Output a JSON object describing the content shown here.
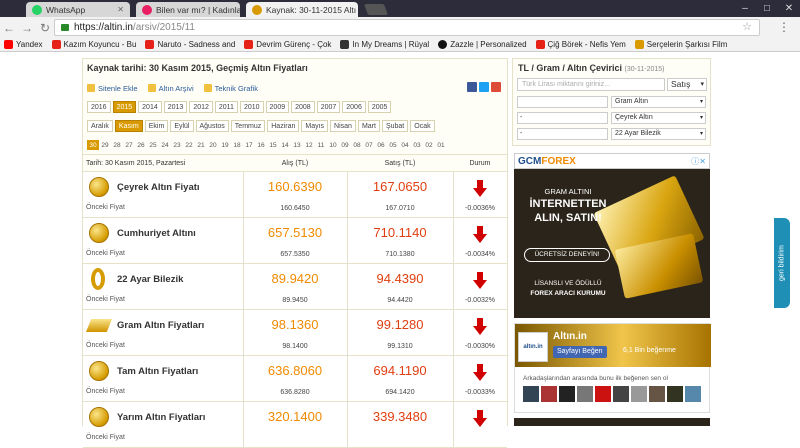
{
  "browser": {
    "tabs": [
      {
        "title": "WhatsApp",
        "color": "#25d366"
      },
      {
        "title": "Bilen var mı? | Kadınlar K",
        "color": "#e91e63"
      },
      {
        "title": "Kaynak: 30-11-2015 Altı",
        "color": "#d99a00"
      }
    ],
    "window_buttons": [
      "–",
      "□",
      "✕"
    ],
    "url_domain": "https://altin.in",
    "url_path": "/arsiv/2015/11",
    "bookmarks": [
      {
        "label": "Yandex",
        "color": "#ff0000"
      },
      {
        "label": "Kazım Koyuncu - Bu",
        "color": "#e62117"
      },
      {
        "label": "Naruto - Sadness and",
        "color": "#e62117"
      },
      {
        "label": "Devrim Gürenç - Çok",
        "color": "#e62117"
      },
      {
        "label": "In My Dreams | Rüyal",
        "color": "#333333"
      },
      {
        "label": "Zazzle | Personalized",
        "color": "#111111"
      },
      {
        "label": "Çiğ Börek - Nefis Yem",
        "color": "#e62117"
      },
      {
        "label": "Serçelerin Şarkısı Film",
        "color": "#d99a00"
      }
    ]
  },
  "page": {
    "title": "Kaynak tarihi: 30 Kasım 2015, Geçmiş Altın Fiyatları",
    "tools": [
      "Sitenle Ekle",
      "Altın Arşivi",
      "Teknik Grafik"
    ],
    "years": [
      "2016",
      "2015",
      "2014",
      "2013",
      "2012",
      "2011",
      "2010",
      "2009",
      "2008",
      "2007",
      "2006",
      "2005"
    ],
    "selected_year": "2015",
    "months": [
      "Aralık",
      "Kasım",
      "Ekim",
      "Eylül",
      "Ağustos",
      "Temmuz",
      "Haziran",
      "Mayıs",
      "Nisan",
      "Mart",
      "Şubat",
      "Ocak"
    ],
    "selected_month": "Kasım",
    "days": [
      "30",
      "29",
      "28",
      "27",
      "26",
      "25",
      "24",
      "23",
      "22",
      "21",
      "20",
      "19",
      "18",
      "17",
      "16",
      "15",
      "14",
      "13",
      "12",
      "11",
      "10",
      "09",
      "08",
      "07",
      "06",
      "05",
      "04",
      "03",
      "02",
      "01"
    ],
    "selected_day": "30",
    "table": {
      "date_header": "Tarih: 30 Kasım 2015, Pazartesi",
      "buy_header": "Alış (TL)",
      "sell_header": "Satış (TL)",
      "status_header": "Durum",
      "prev_label": "Önceki Fiyat",
      "rows": [
        {
          "name": "Çeyrek Altın Fiyatı",
          "buy": "160.6390",
          "sell": "167.0650",
          "prev_buy": "160.6450",
          "prev_sell": "167.0710",
          "change": "-0.0036%",
          "icon": "coin"
        },
        {
          "name": "Cumhuriyet Altını",
          "buy": "657.5130",
          "sell": "710.1140",
          "prev_buy": "657.5350",
          "prev_sell": "710.1380",
          "change": "-0.0034%",
          "icon": "coin"
        },
        {
          "name": "22 Ayar Bilezik",
          "buy": "89.9420",
          "sell": "94.4390",
          "prev_buy": "89.9450",
          "prev_sell": "94.4420",
          "change": "-0.0032%",
          "icon": "ring"
        },
        {
          "name": "Gram Altın Fiyatları",
          "buy": "98.1360",
          "sell": "99.1280",
          "prev_buy": "98.1400",
          "prev_sell": "99.1310",
          "change": "-0.0030%",
          "icon": "bar"
        },
        {
          "name": "Tam Altın Fiyatları",
          "buy": "636.8060",
          "sell": "694.1190",
          "prev_buy": "636.8280",
          "prev_sell": "694.1420",
          "change": "-0.0033%",
          "icon": "coin"
        },
        {
          "name": "Yarım Altın Fiyatları",
          "buy": "320.1400",
          "sell": "339.3480",
          "prev_buy": "",
          "prev_sell": "",
          "change": "",
          "icon": "coin"
        }
      ]
    }
  },
  "converter": {
    "title": "TL / Gram / Altın Çevirici",
    "date": "(30-11-2015)",
    "amount_placeholder": "Türk Lirası miktarını giriniz...",
    "mode": "Satış",
    "rows": [
      {
        "value": "",
        "select": "Gram Altın"
      },
      {
        "value": "-",
        "select": "Çeyrek Altın"
      },
      {
        "value": "-",
        "select": "22 Ayar Bilezik"
      }
    ]
  },
  "ad": {
    "brand_a": "GCM",
    "brand_b": "FOREX",
    "line1": "GRAM ALTINI",
    "line2": "İNTERNETTEN",
    "line3": "ALIN, SATIN!",
    "button": "ÜCRETSİZ DENEYİN!",
    "line4": "LİSANSLI VE ÖDÜLLÜ",
    "line5": "FOREX ARACI KURUMU"
  },
  "facebook": {
    "page_name": "Altın.in",
    "like_button": "Sayfayı Beğen",
    "like_count": "6,1 Bin beğenme",
    "friends_text": "Arkadaşlarından arasında bunu ilk beğenen sen ol"
  },
  "feedback_label": "geri bildirim"
}
